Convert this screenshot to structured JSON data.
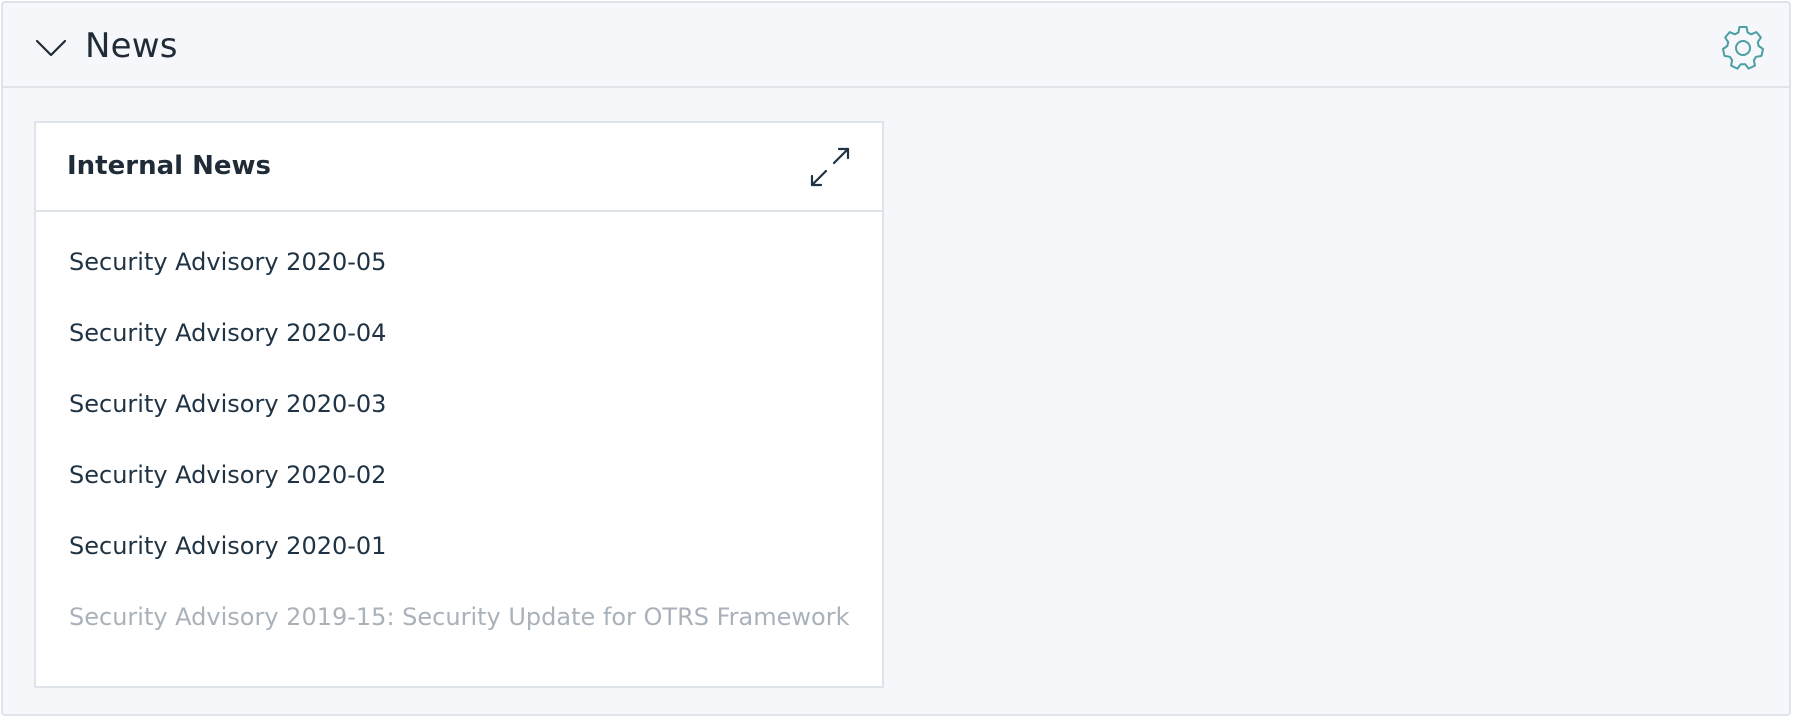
{
  "section": {
    "title": "News",
    "toggle_icon": "chevron-down-icon",
    "settings_icon": "gear-icon",
    "accent_color": "#4b9ea3"
  },
  "widget": {
    "title": "Internal News",
    "expand_icon": "expand-arrows-icon",
    "items": [
      {
        "label": "Security Advisory 2020-05"
      },
      {
        "label": "Security Advisory 2020-04"
      },
      {
        "label": "Security Advisory 2020-03"
      },
      {
        "label": "Security Advisory 2020-02"
      },
      {
        "label": "Security Advisory 2020-01"
      },
      {
        "label": "Security Advisory 2019-15: Security Update for OTRS Framework"
      }
    ]
  }
}
